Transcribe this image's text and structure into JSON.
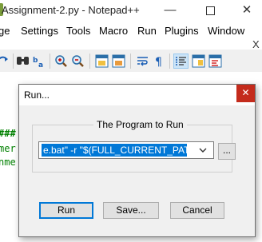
{
  "app": {
    "title": "Assignment-2.py - Notepad++",
    "window_controls": {
      "minimize": "—",
      "close": "✕"
    },
    "doc_close": "X"
  },
  "menubar": {
    "items": [
      "ge",
      "Settings",
      "Tools",
      "Macro",
      "Run",
      "Plugins",
      "Window"
    ]
  },
  "editor": {
    "lines": [
      "###",
      "mer",
      "nme"
    ],
    "line_colors": [
      "#008000",
      "#008000",
      "#008000"
    ]
  },
  "dialog": {
    "title": "Run...",
    "close": "✕",
    "group_title": "The Program to Run",
    "command_value": "e.bat\" -r \"$(FULL_CURRENT_PATH)\"",
    "browse_label": "...",
    "buttons": {
      "run": "Run",
      "save": "Save...",
      "cancel": "Cancel"
    }
  },
  "colors": {
    "selection": "#0078d7",
    "close_red": "#c42b1c",
    "dialog_bg": "#f0f0f0"
  }
}
